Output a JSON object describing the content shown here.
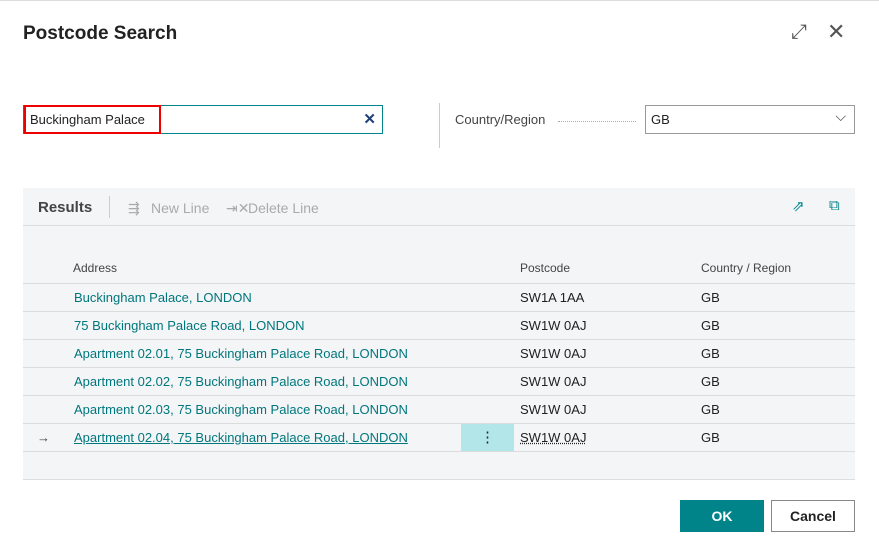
{
  "dialog": {
    "title": "Postcode Search"
  },
  "search": {
    "value": "Buckingham Palace"
  },
  "country": {
    "label": "Country/Region",
    "value": "GB"
  },
  "results": {
    "title": "Results",
    "new_line": "New Line",
    "delete_line": "Delete Line",
    "columns": [
      "Address",
      "Postcode",
      "Country / Region"
    ],
    "rows": [
      {
        "address": "Buckingham Palace, LONDON",
        "postcode": "SW1A 1AA",
        "country": "GB"
      },
      {
        "address": "75 Buckingham Palace Road, LONDON",
        "postcode": "SW1W 0AJ",
        "country": "GB"
      },
      {
        "address": "Apartment 02.01, 75 Buckingham Palace Road, LONDON",
        "postcode": "SW1W 0AJ",
        "country": "GB"
      },
      {
        "address": "Apartment 02.02, 75 Buckingham Palace Road, LONDON",
        "postcode": "SW1W 0AJ",
        "country": "GB"
      },
      {
        "address": "Apartment 02.03, 75 Buckingham Palace Road, LONDON",
        "postcode": "SW1W 0AJ",
        "country": "GB"
      },
      {
        "address": "Apartment 02.04, 75 Buckingham Palace Road, LONDON",
        "postcode": "SW1W 0AJ",
        "country": "GB"
      }
    ]
  },
  "buttons": {
    "ok": "OK",
    "cancel": "Cancel"
  }
}
